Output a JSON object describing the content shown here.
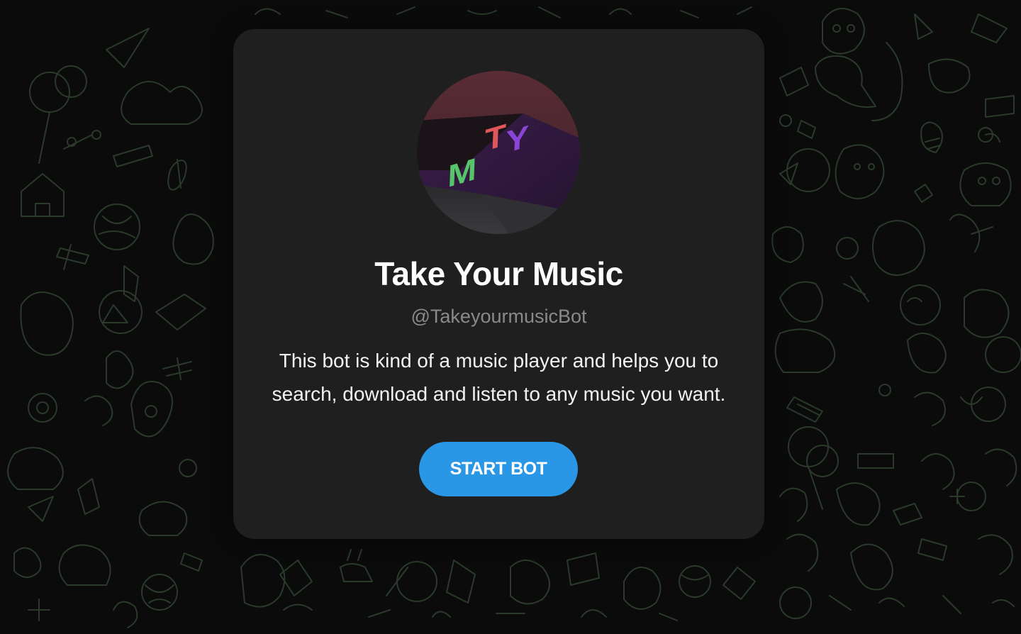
{
  "bot": {
    "name": "Take Your Music",
    "username": "@TakeyourmusicBot",
    "description_line1": "This bot is kind of a music player and helps you to",
    "description_line2": "search, download and listen to any music you want.",
    "avatar_letters": {
      "t": "T",
      "y": "Y",
      "m": "M"
    }
  },
  "actions": {
    "start_label": "START BOT"
  },
  "colors": {
    "background": "#0a0b0a",
    "pattern_stroke": "#2a3a2a",
    "card": "#1f1f1f",
    "button": "#2a97e6",
    "title": "#ffffff",
    "username": "#8a8a8a"
  },
  "icons": {
    "pattern": "doodle-pattern-icons",
    "avatar": "tym-logo"
  }
}
